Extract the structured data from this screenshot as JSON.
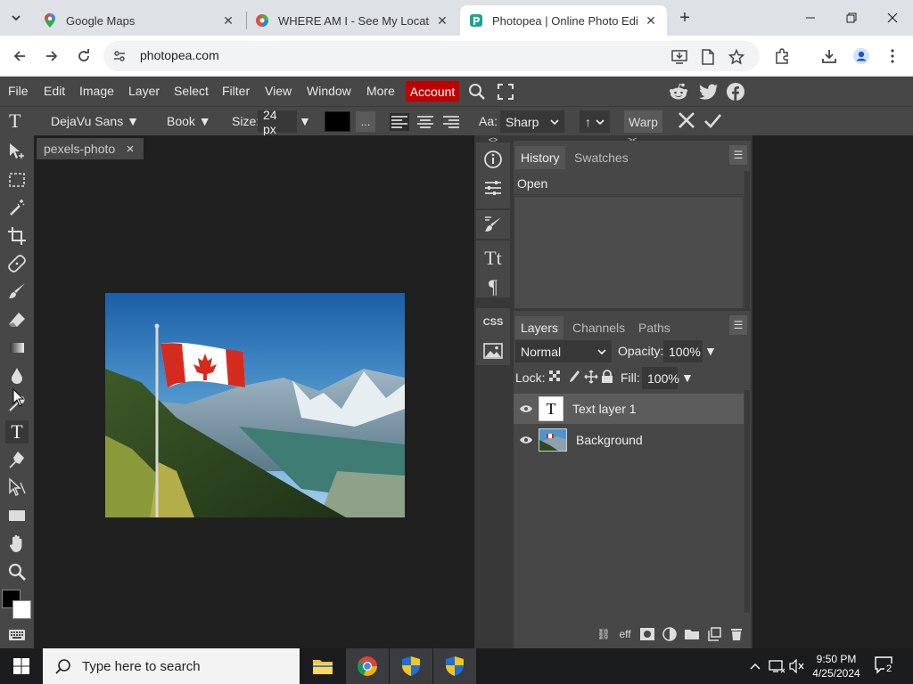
{
  "browser": {
    "tabs": [
      {
        "title": "Google Maps",
        "favicon": "google-maps-pin-icon",
        "active": false
      },
      {
        "title": "WHERE AM I - See My Location",
        "favicon": "globe-icon",
        "active": false
      },
      {
        "title": "Photopea | Online Photo Editor",
        "favicon": "photopea-icon",
        "active": true
      }
    ],
    "url": "photopea.com"
  },
  "photopea": {
    "menu": [
      "File",
      "Edit",
      "Image",
      "Layer",
      "Select",
      "Filter",
      "View",
      "Window",
      "More"
    ],
    "account_label": "Account",
    "options": {
      "font_family": "DejaVu Sans",
      "font_style": "Book",
      "size_label": "Size:",
      "size_value": "24 px",
      "text_color": "#000000",
      "dots_label": "...",
      "aa_label": "Aa:",
      "aa_value": "Sharp",
      "orientation_value": "↑",
      "warp_label": "Warp"
    },
    "document": {
      "tab_name": "pexels-photo",
      "close_glyph": "×"
    },
    "history_panel": {
      "tabs": [
        "History",
        "Swatches"
      ],
      "items": [
        "Open"
      ]
    },
    "layers_panel": {
      "tabs": [
        "Layers",
        "Channels",
        "Paths"
      ],
      "blend_mode": "Normal",
      "opacity_label": "Opacity:",
      "opacity_value": "100%",
      "lock_label": "Lock:",
      "fill_label": "Fill:",
      "fill_value": "100%",
      "layers": [
        {
          "name": "Text layer 1",
          "type": "text",
          "selected": true,
          "visible": true
        },
        {
          "name": "Background",
          "type": "image",
          "selected": false,
          "visible": true
        }
      ]
    },
    "colors": {
      "foreground": "#000000",
      "background": "#ffffff",
      "accent_account": "#c10000"
    }
  },
  "taskbar": {
    "search_placeholder": "Type here to search",
    "time": "9:50 PM",
    "date": "4/25/2024",
    "notification_count": "2"
  }
}
